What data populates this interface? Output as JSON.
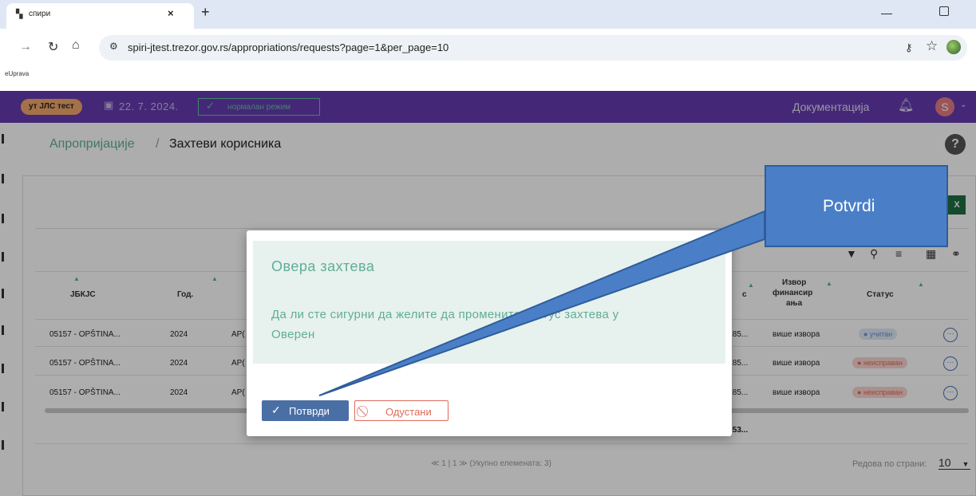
{
  "browser": {
    "tab_title": "спири",
    "tab_close": "×",
    "new_tab": "+",
    "url": "spiri-jtest.trezor.gov.rs/appropriations/requests?page=1&per_page=10",
    "bookmark": "eUprava",
    "icons": [
      "forward-icon",
      "reload-icon",
      "home-icon",
      "site-info-icon",
      "key-icon",
      "star-icon"
    ]
  },
  "header": {
    "env_badge": "ут ЈЛС тест",
    "date": "22. 7. 2024.",
    "mode": "нормалан режим",
    "docs_link": "Документација",
    "user_initial": "S"
  },
  "page": {
    "breadcrumb_root": "Апропријације",
    "breadcrumb_sep": "/",
    "breadcrumb_current": "Захтеви корисника",
    "help": "?"
  },
  "table": {
    "headers": {
      "jbkjs": "ЈБКЈС",
      "year": "Год.",
      "partial_c": "с",
      "source_1": "Извор",
      "source_2": "финансир",
      "source_3": "ања",
      "status": "Статус"
    },
    "rows": [
      {
        "jbkjs": "05157 - OPŠTINA...",
        "year": "2024",
        "partial": "AP(",
        "amount": ".85...",
        "source": "више извора",
        "status": "учитан",
        "status_kind": "loaded"
      },
      {
        "jbkjs": "05157 - OPŠTINA...",
        "year": "2024",
        "partial": "AP(",
        "amount": ".85...",
        "source": "више извора",
        "status": "неисправан",
        "status_kind": "error"
      },
      {
        "jbkjs": "05157 - OPŠTINA...",
        "year": "2024",
        "partial": "AP(",
        "amount": ".85...",
        "source": "више извора",
        "status": "неисправан",
        "status_kind": "error"
      }
    ],
    "total_partial": ",53...",
    "pagination": "≪  1 | 1  ≫  (Укупно елемената: 3)",
    "per_page_label": "Редова по страни:",
    "per_page_value": "10"
  },
  "modal": {
    "title": "Овера захтева",
    "message_line1": "Да ли сте сигурни да желите да промените статус захтева у",
    "message_line2": "Оверен",
    "confirm_label": "Потврди",
    "cancel_label": "Одустани"
  },
  "callout": {
    "text": "Potvrdi"
  },
  "colors": {
    "app_bar": "#653bb0",
    "accent_green": "#5fae97",
    "confirm_button": "#4a6fa5",
    "cancel_border": "#e06b5a",
    "callout_fill": "#4a7fc8"
  }
}
